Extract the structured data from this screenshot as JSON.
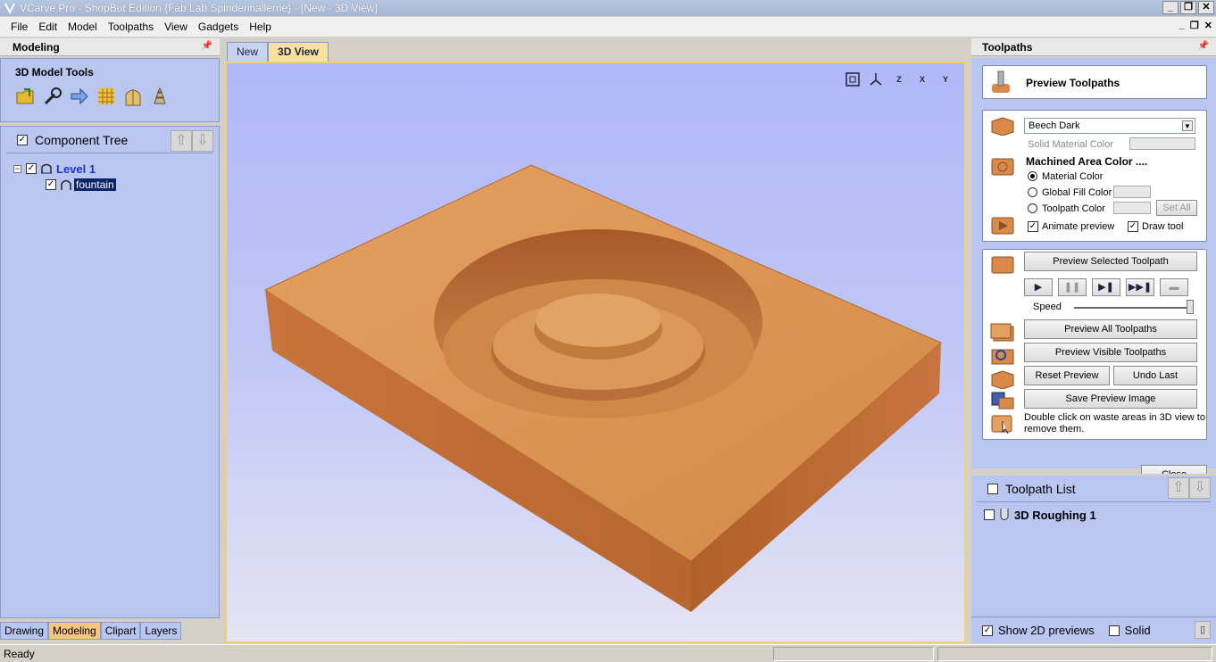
{
  "window": {
    "title": "VCarve Pro - ShopBot Edition {Fab Lab Spinderihallerne} - [New - 3D View]"
  },
  "menu": [
    "File",
    "Edit",
    "Model",
    "Toolpaths",
    "View",
    "Gadgets",
    "Help"
  ],
  "left_panel": {
    "title": "Modeling",
    "tools_title": "3D Model Tools",
    "tools": [
      "import-component-icon",
      "model-tool-icon",
      "move-component-icon",
      "texture-icon",
      "shape-tool-icon",
      "slice-icon"
    ],
    "tree_title": "Component Tree",
    "tree_checked": true,
    "level_label": "Level 1",
    "component_label": "fountain",
    "tabs": [
      "Drawing",
      "Modeling",
      "Clipart",
      "Layers"
    ],
    "active_tab": "Modeling"
  },
  "doc_tabs": [
    "New",
    "3D View"
  ],
  "active_doc_tab": "3D View",
  "view_icons": [
    "zoom-extents-icon",
    "iso-view-icon",
    "z-view-icon",
    "x-view-icon",
    "y-view-icon"
  ],
  "view_icon_labels": [
    "",
    "",
    "Z",
    "X",
    "Y"
  ],
  "right_panel": {
    "title": "Toolpaths",
    "card_title": "Preview Toolpaths",
    "material": "Beech Dark",
    "solid_material_label": "Solid Material Color",
    "machined_label": "Machined Area Color ....",
    "radio_material": "Material Color",
    "radio_global": "Global Fill Color",
    "radio_toolpath": "Toolpath Color",
    "set_all": "Set All",
    "animate_preview": "Animate preview",
    "draw_tool": "Draw tool",
    "preview_selected": "Preview Selected Toolpath",
    "speed_label": "Speed",
    "preview_all": "Preview All Toolpaths",
    "preview_visible": "Preview Visible Toolpaths",
    "reset_preview": "Reset Preview",
    "undo_last": "Undo Last",
    "save_preview": "Save Preview Image",
    "hint": "Double click on waste areas in 3D view to remove them.",
    "close": "Close",
    "toolpath_list_title": "Toolpath List",
    "toolpaths": [
      "3D Roughing 1"
    ],
    "show_2d_previews": "Show 2D previews",
    "solid": "Solid"
  },
  "status": {
    "text": "Ready"
  },
  "colors": {
    "panel_blue": "#b8c6f0",
    "active_tab": "#f5c77a",
    "wood": "#d9894a"
  }
}
